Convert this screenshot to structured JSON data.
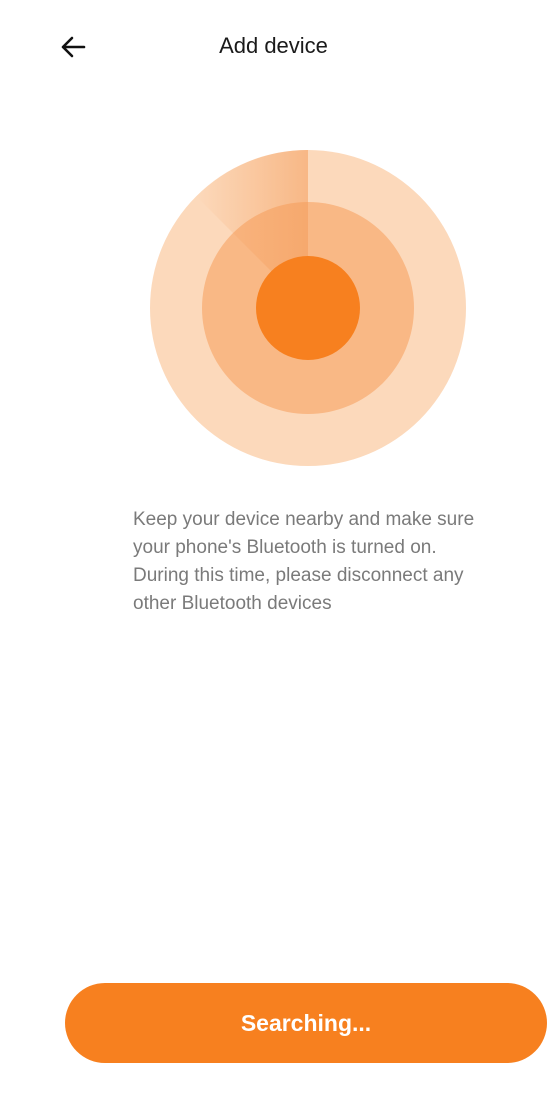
{
  "header": {
    "title": "Add device",
    "back_icon": "arrow-left-icon"
  },
  "scan": {
    "icon": "bluetooth-radar-icon",
    "colors": {
      "outer": "#fcd9bb",
      "middle": "#f9b885",
      "center": "#f7801f",
      "sweep": "#f49c5a"
    },
    "message": "Keep your device nearby and make sure your phone's Bluetooth is turned on. During this time, please disconnect any other Bluetooth devices"
  },
  "action": {
    "label": "Searching...",
    "color": "#f7801f"
  }
}
